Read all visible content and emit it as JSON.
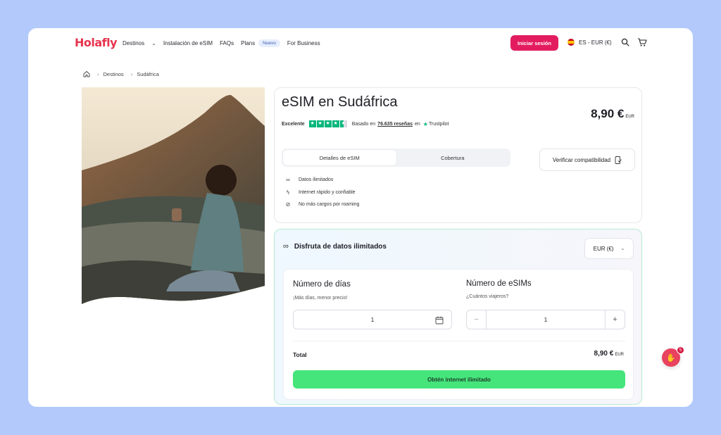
{
  "header": {
    "logo": "Holafly",
    "nav": [
      {
        "label": "Destinos",
        "has_dropdown": true
      },
      {
        "label": "Instalación de eSIM"
      },
      {
        "label": "FAQs"
      },
      {
        "label": "Plans",
        "badge": "Nuevo"
      },
      {
        "label": "For Business"
      }
    ],
    "login_label": "Iniciar sesión",
    "language_currency": "ES - EUR (€)",
    "icons": [
      "spain-flag-icon",
      "search-icon",
      "cart-icon"
    ]
  },
  "breadcrumb": {
    "home_icon": "home-icon",
    "items": [
      "Destinos",
      "Sudáfrica"
    ]
  },
  "hero": {
    "image": "woman-sitting-on-mountain-overlooking-city"
  },
  "product": {
    "title": "eSIM en Sudáfrica",
    "price": "8,90 €",
    "price_currency": "EUR",
    "rating_label": "Excelente",
    "stars": 4.5,
    "reviews_prefix": "Basado en",
    "reviews_count": "76.635 reseñas",
    "reviews_suffix": "en",
    "trustpilot": "Trustpilot",
    "tabs": [
      "Detalles de eSIM",
      "Cobertura"
    ],
    "active_tab": 0,
    "compat_label": "Verificar compatibilidad",
    "features": [
      {
        "icon": "infinity-icon",
        "text": "Datos ilimitados"
      },
      {
        "icon": "lightning-icon",
        "text": "Internet rápido y confiable"
      },
      {
        "icon": "no-roaming-icon",
        "text": "No más cargos por roaming"
      }
    ]
  },
  "purchase": {
    "heading": "Disfruta de datos ilimitados",
    "currency_select": "EUR (€)",
    "days": {
      "title": "Número de días",
      "subtitle": "¡Más días, menor precio!",
      "value": "1"
    },
    "esims": {
      "title": "Número de eSIMs",
      "subtitle": "¿Cuántos viajeros?",
      "value": "1"
    },
    "total_label": "Total",
    "total_value": "8,90 €",
    "total_currency": "EUR",
    "cta_label": "Obtén internet ilimitado"
  },
  "chat": {
    "badge_count": "5"
  },
  "colors": {
    "brand": "#e8344e",
    "login_button": "#e31c5f",
    "cta": "#45e57c",
    "trustpilot": "#00b67a",
    "background": "#b3c9fb"
  }
}
